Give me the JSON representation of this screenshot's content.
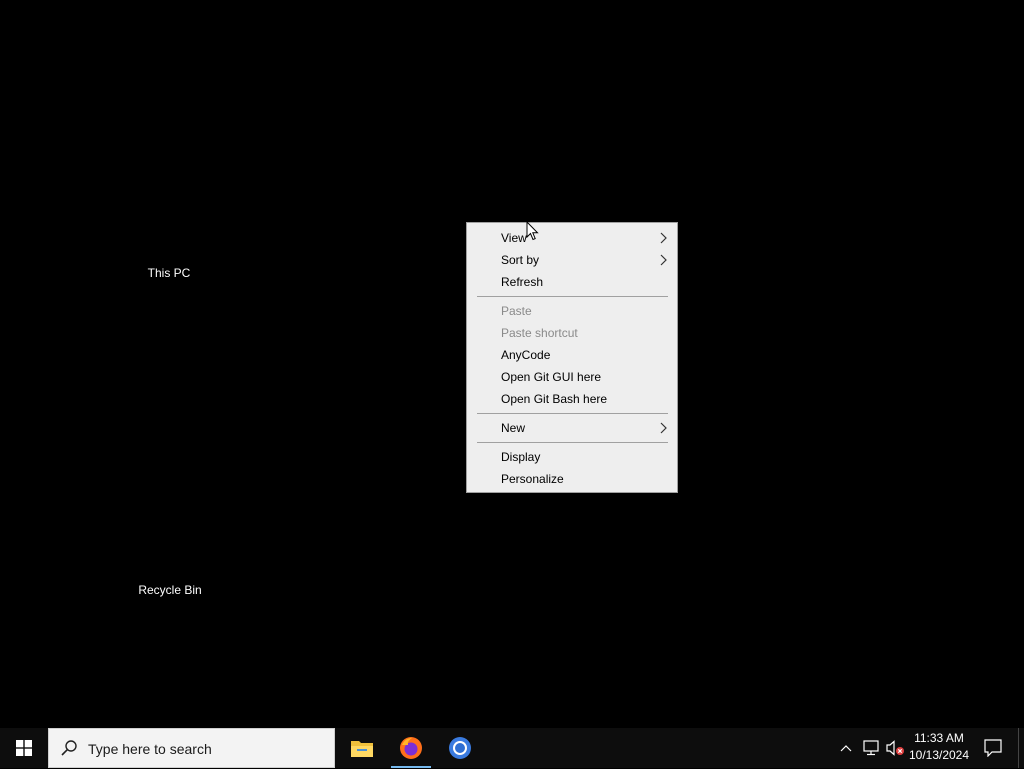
{
  "desktop": {
    "icons": [
      {
        "label": "This PC"
      },
      {
        "label": "Recycle Bin"
      }
    ]
  },
  "context_menu": {
    "items": [
      {
        "label": "View",
        "submenu": true,
        "enabled": true
      },
      {
        "label": "Sort by",
        "submenu": true,
        "enabled": true
      },
      {
        "label": "Refresh",
        "submenu": false,
        "enabled": true
      },
      {
        "label": "Paste",
        "submenu": false,
        "enabled": false
      },
      {
        "label": "Paste shortcut",
        "submenu": false,
        "enabled": false
      },
      {
        "label": "AnyCode",
        "submenu": false,
        "enabled": true
      },
      {
        "label": "Open Git GUI here",
        "submenu": false,
        "enabled": true
      },
      {
        "label": "Open Git Bash here",
        "submenu": false,
        "enabled": true
      },
      {
        "label": "New",
        "submenu": true,
        "enabled": true
      },
      {
        "label": "Display",
        "submenu": false,
        "enabled": true
      },
      {
        "label": "Personalize",
        "submenu": false,
        "enabled": true
      }
    ]
  },
  "taskbar": {
    "search_placeholder": "Type here to search",
    "apps": [
      {
        "icon": "file-explorer-icon",
        "active": false
      },
      {
        "icon": "firefox-icon",
        "active": true
      },
      {
        "icon": "chrome-icon",
        "active": false
      }
    ],
    "tray": {
      "icons": [
        "chevron-up-icon",
        "network-icon",
        "volume-muted-icon"
      ]
    },
    "clock": {
      "time": "11:33 AM",
      "date": "10/13/2024"
    }
  },
  "colors": {
    "desktop_background": "#000000",
    "menu_background": "#eeeeee",
    "menu_disabled_text": "#8a8a8a",
    "taskbar_background": "#0d0d0d",
    "active_app_indicator": "#76b9ed"
  }
}
